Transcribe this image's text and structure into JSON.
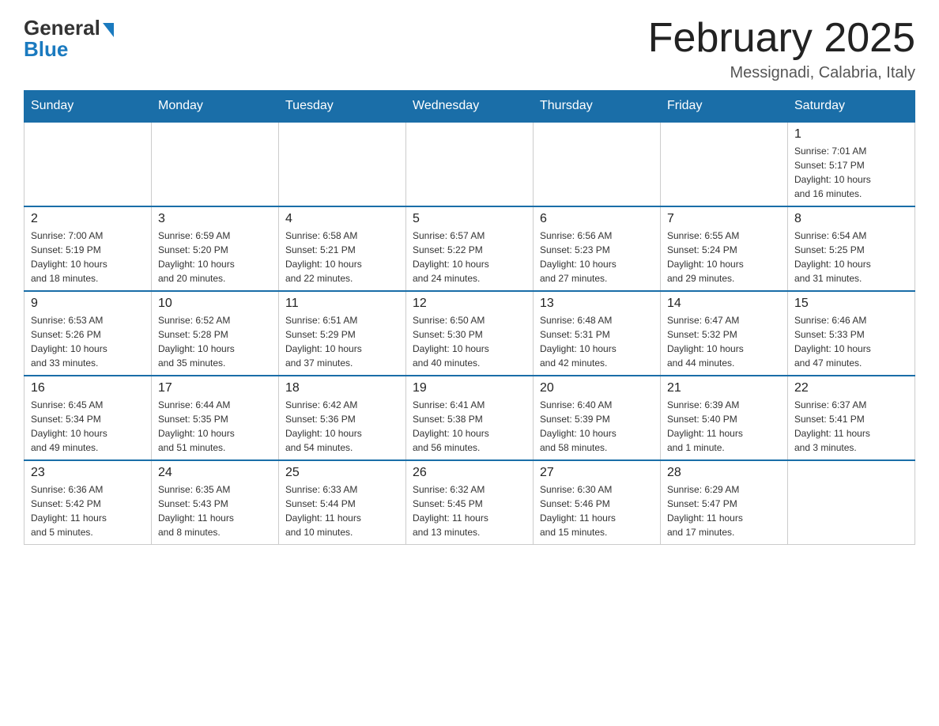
{
  "logo": {
    "general_text": "General",
    "blue_text": "Blue"
  },
  "header": {
    "title": "February 2025",
    "location": "Messignadi, Calabria, Italy"
  },
  "weekdays": [
    "Sunday",
    "Monday",
    "Tuesday",
    "Wednesday",
    "Thursday",
    "Friday",
    "Saturday"
  ],
  "weeks": [
    [
      {
        "day": "",
        "info": ""
      },
      {
        "day": "",
        "info": ""
      },
      {
        "day": "",
        "info": ""
      },
      {
        "day": "",
        "info": ""
      },
      {
        "day": "",
        "info": ""
      },
      {
        "day": "",
        "info": ""
      },
      {
        "day": "1",
        "info": "Sunrise: 7:01 AM\nSunset: 5:17 PM\nDaylight: 10 hours\nand 16 minutes."
      }
    ],
    [
      {
        "day": "2",
        "info": "Sunrise: 7:00 AM\nSunset: 5:19 PM\nDaylight: 10 hours\nand 18 minutes."
      },
      {
        "day": "3",
        "info": "Sunrise: 6:59 AM\nSunset: 5:20 PM\nDaylight: 10 hours\nand 20 minutes."
      },
      {
        "day": "4",
        "info": "Sunrise: 6:58 AM\nSunset: 5:21 PM\nDaylight: 10 hours\nand 22 minutes."
      },
      {
        "day": "5",
        "info": "Sunrise: 6:57 AM\nSunset: 5:22 PM\nDaylight: 10 hours\nand 24 minutes."
      },
      {
        "day": "6",
        "info": "Sunrise: 6:56 AM\nSunset: 5:23 PM\nDaylight: 10 hours\nand 27 minutes."
      },
      {
        "day": "7",
        "info": "Sunrise: 6:55 AM\nSunset: 5:24 PM\nDaylight: 10 hours\nand 29 minutes."
      },
      {
        "day": "8",
        "info": "Sunrise: 6:54 AM\nSunset: 5:25 PM\nDaylight: 10 hours\nand 31 minutes."
      }
    ],
    [
      {
        "day": "9",
        "info": "Sunrise: 6:53 AM\nSunset: 5:26 PM\nDaylight: 10 hours\nand 33 minutes."
      },
      {
        "day": "10",
        "info": "Sunrise: 6:52 AM\nSunset: 5:28 PM\nDaylight: 10 hours\nand 35 minutes."
      },
      {
        "day": "11",
        "info": "Sunrise: 6:51 AM\nSunset: 5:29 PM\nDaylight: 10 hours\nand 37 minutes."
      },
      {
        "day": "12",
        "info": "Sunrise: 6:50 AM\nSunset: 5:30 PM\nDaylight: 10 hours\nand 40 minutes."
      },
      {
        "day": "13",
        "info": "Sunrise: 6:48 AM\nSunset: 5:31 PM\nDaylight: 10 hours\nand 42 minutes."
      },
      {
        "day": "14",
        "info": "Sunrise: 6:47 AM\nSunset: 5:32 PM\nDaylight: 10 hours\nand 44 minutes."
      },
      {
        "day": "15",
        "info": "Sunrise: 6:46 AM\nSunset: 5:33 PM\nDaylight: 10 hours\nand 47 minutes."
      }
    ],
    [
      {
        "day": "16",
        "info": "Sunrise: 6:45 AM\nSunset: 5:34 PM\nDaylight: 10 hours\nand 49 minutes."
      },
      {
        "day": "17",
        "info": "Sunrise: 6:44 AM\nSunset: 5:35 PM\nDaylight: 10 hours\nand 51 minutes."
      },
      {
        "day": "18",
        "info": "Sunrise: 6:42 AM\nSunset: 5:36 PM\nDaylight: 10 hours\nand 54 minutes."
      },
      {
        "day": "19",
        "info": "Sunrise: 6:41 AM\nSunset: 5:38 PM\nDaylight: 10 hours\nand 56 minutes."
      },
      {
        "day": "20",
        "info": "Sunrise: 6:40 AM\nSunset: 5:39 PM\nDaylight: 10 hours\nand 58 minutes."
      },
      {
        "day": "21",
        "info": "Sunrise: 6:39 AM\nSunset: 5:40 PM\nDaylight: 11 hours\nand 1 minute."
      },
      {
        "day": "22",
        "info": "Sunrise: 6:37 AM\nSunset: 5:41 PM\nDaylight: 11 hours\nand 3 minutes."
      }
    ],
    [
      {
        "day": "23",
        "info": "Sunrise: 6:36 AM\nSunset: 5:42 PM\nDaylight: 11 hours\nand 5 minutes."
      },
      {
        "day": "24",
        "info": "Sunrise: 6:35 AM\nSunset: 5:43 PM\nDaylight: 11 hours\nand 8 minutes."
      },
      {
        "day": "25",
        "info": "Sunrise: 6:33 AM\nSunset: 5:44 PM\nDaylight: 11 hours\nand 10 minutes."
      },
      {
        "day": "26",
        "info": "Sunrise: 6:32 AM\nSunset: 5:45 PM\nDaylight: 11 hours\nand 13 minutes."
      },
      {
        "day": "27",
        "info": "Sunrise: 6:30 AM\nSunset: 5:46 PM\nDaylight: 11 hours\nand 15 minutes."
      },
      {
        "day": "28",
        "info": "Sunrise: 6:29 AM\nSunset: 5:47 PM\nDaylight: 11 hours\nand 17 minutes."
      },
      {
        "day": "",
        "info": ""
      }
    ]
  ]
}
